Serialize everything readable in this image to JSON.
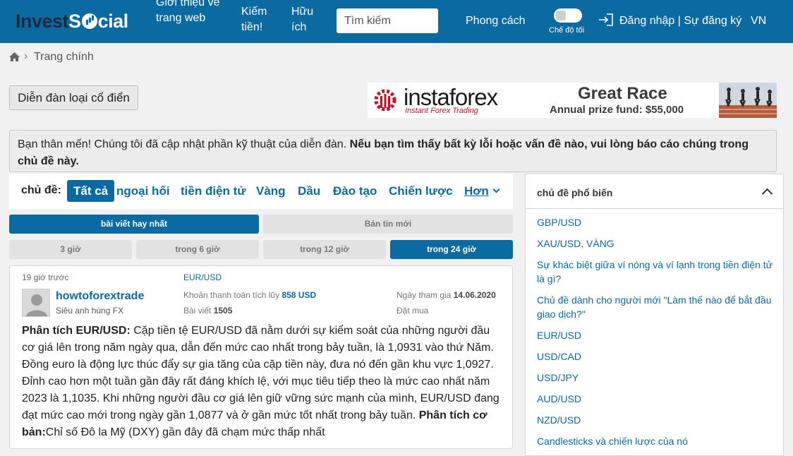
{
  "header": {
    "logo_invest": "Invest",
    "logo_s": "S",
    "logo_cial": "cial",
    "nav_intro": "Giới thiệu về trang web",
    "nav_earn": "Kiếm tiền!",
    "nav_useful": "Hữu ích",
    "search_placeholder": "Tìm kiếm",
    "nav_style": "Phong cách",
    "dark_mode": "Chế độ tối",
    "auth": "Đăng nhập | Sự đăng ký",
    "lang": "VN"
  },
  "breadcrumb": {
    "sep": "›",
    "home": "Trang chính"
  },
  "classic_button": "Diễn đàn loại cổ điển",
  "banner": {
    "brand": "instaforex",
    "tagline": "Instant Forex Trading",
    "race": "Great Race",
    "prize_label": "Annual prize fund:",
    "prize_value": "$55,000"
  },
  "notice": {
    "normal": "Bạn thân mến! Chúng tôi đã cập nhật phần kỹ thuật của diễn đàn. ",
    "bold": "Nếu bạn tìm thấy bất kỳ lỗi hoặc vấn đề nào, vui lòng báo cáo chúng trong chủ đề này."
  },
  "topics": {
    "label": "chủ đề:",
    "items": [
      "Tất cả",
      "ngoại hối",
      "tiền điện tử",
      "Vàng",
      "Dầu",
      "Đào tạo",
      "Chiến lược",
      "Hơn"
    ]
  },
  "sort": {
    "best": "bài viết hay nhất",
    "news": "Bản tin mới"
  },
  "time_filter": [
    "3 giờ",
    "trong 6 giờ",
    "trong 12 giờ",
    "trong 24 giờ"
  ],
  "post": {
    "time": "19 giờ trước",
    "pair": "EUR/USD",
    "username": "howtoforextrade",
    "rank": "Siêu anh hùng FX",
    "payments_label": "Khoản thanh toán tích lũy",
    "payments_value": "858 USD",
    "posts_label": "Bài viết",
    "posts_value": "1505",
    "joined_label": "Ngày tham gia",
    "joined_value": "14.06.2020",
    "buy_label": "Đặt mua",
    "heading1": "Phân tích EUR/USD:",
    "text1": " Cặp tiền tệ EUR/USD đã nằm dưới sự kiểm soát của những người đầu cơ giá lên trong năm ngày qua, dẫn đến mức cao nhất trong bảy tuần, là 1,0931 vào thứ Năm. Đồng euro là động lực thúc đẩy sự gia tăng của cặp tiền này, đưa nó đến gần khu vực 1,0927. Đỉnh cao hơn một tuần gần đây rất đáng khích lệ, với mục tiêu tiếp theo là mức cao nhất năm 2023 là 1,1035. Khi những người đầu cơ giá lên giữ vững sức mạnh của mình, EUR/USD đang đạt mức cao mới trong ngày gần 1,0877 và ở gần mức tốt nhất trong bảy tuần. ",
    "heading2": "Phân tích cơ bản:",
    "text2": "Chỉ số Đô la Mỹ (DXY) gần đây đã chạm mức thấp nhất"
  },
  "sidebar": {
    "title": "chủ đề phổ biến",
    "links": [
      "GBP/USD",
      "XAU/USD, VÀNG",
      "Sự khác biệt giữa ví nóng và ví lạnh trong tiền điện tử là gì?",
      "Chủ đề dành cho người mới \"Làm thế nào để bắt đầu giao dịch?\"",
      "EUR/USD",
      "USD/CAD",
      "USD/JPY",
      "AUD/USD",
      "NZD/USD",
      "Candlesticks và chiến lược của nó"
    ]
  }
}
